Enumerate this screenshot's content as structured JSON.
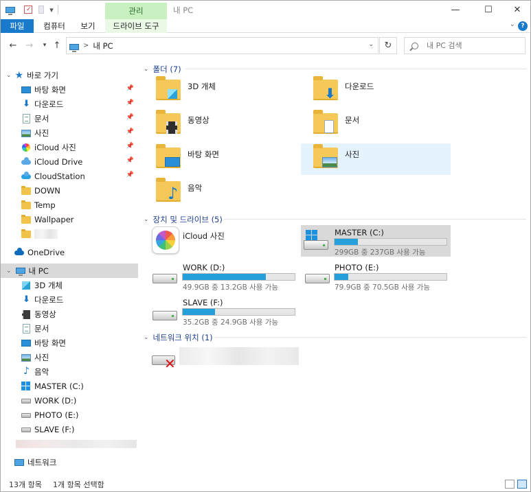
{
  "title_bar": {
    "context_tab_label": "관리",
    "window_title": "내 PC",
    "minimize_glyph": "—",
    "maximize_glyph": "☐",
    "close_glyph": "✕"
  },
  "ribbon": {
    "tabs": [
      {
        "label": "파일"
      },
      {
        "label": "컴퓨터"
      },
      {
        "label": "보기"
      },
      {
        "label": "드라이브 도구"
      }
    ],
    "help_glyph": "?"
  },
  "address_bar": {
    "separator": ">",
    "path": "내 PC",
    "search_placeholder": "내 PC 검색"
  },
  "nav_pane": {
    "quick_access": {
      "label": "바로 가기",
      "items": [
        {
          "label": "바탕 화면",
          "icon": "desktop-icon",
          "pinned": true
        },
        {
          "label": "다운로드",
          "icon": "download-icon",
          "pinned": true
        },
        {
          "label": "문서",
          "icon": "document-icon",
          "pinned": true
        },
        {
          "label": "사진",
          "icon": "pictures-icon",
          "pinned": true
        },
        {
          "label": "iCloud 사진",
          "icon": "icloud-photos-icon",
          "pinned": true
        },
        {
          "label": "iCloud Drive",
          "icon": "icloud-drive-icon",
          "pinned": true
        },
        {
          "label": "CloudStation",
          "icon": "cloudstation-icon",
          "pinned": true
        },
        {
          "label": "DOWN",
          "icon": "folder-icon",
          "pinned": false
        },
        {
          "label": "Temp",
          "icon": "folder-icon",
          "pinned": false
        },
        {
          "label": "Wallpaper",
          "icon": "folder-icon",
          "pinned": false
        }
      ]
    },
    "onedrive": {
      "label": "OneDrive"
    },
    "this_pc": {
      "label": "내 PC",
      "items": [
        {
          "label": "3D 개체",
          "icon": "3d-objects-icon"
        },
        {
          "label": "다운로드",
          "icon": "download-icon"
        },
        {
          "label": "동영상",
          "icon": "videos-icon"
        },
        {
          "label": "문서",
          "icon": "document-icon"
        },
        {
          "label": "바탕 화면",
          "icon": "desktop-icon"
        },
        {
          "label": "사진",
          "icon": "pictures-icon"
        },
        {
          "label": "음악",
          "icon": "music-icon"
        },
        {
          "label": "MASTER (C:)",
          "icon": "system-drive-icon"
        },
        {
          "label": "WORK (D:)",
          "icon": "drive-icon"
        },
        {
          "label": "PHOTO (E:)",
          "icon": "drive-icon"
        },
        {
          "label": "SLAVE (F:)",
          "icon": "drive-icon"
        }
      ]
    },
    "network": {
      "label": "네트워크"
    }
  },
  "main": {
    "folders_group": {
      "header": "폴더 (7)",
      "items": [
        {
          "label": "3D 개체",
          "icon": "3d-objects-folder-icon"
        },
        {
          "label": "다운로드",
          "icon": "downloads-folder-icon"
        },
        {
          "label": "동영상",
          "icon": "videos-folder-icon"
        },
        {
          "label": "문서",
          "icon": "documents-folder-icon"
        },
        {
          "label": "바탕 화면",
          "icon": "desktop-folder-icon"
        },
        {
          "label": "사진",
          "icon": "pictures-folder-icon"
        },
        {
          "label": "음악",
          "icon": "music-folder-icon"
        }
      ]
    },
    "devices_group": {
      "header": "장치 및 드라이브 (5)",
      "items": [
        {
          "label": "iCloud 사진",
          "icon": "icloud-photos-app-icon"
        },
        {
          "label": "MASTER (C:)",
          "icon": "system-drive-icon",
          "usage": "299GB 중 237GB 사용 가능",
          "used_fraction": 0.21
        },
        {
          "label": "WORK (D:)",
          "icon": "drive-icon",
          "usage": "49.9GB 중 13.2GB 사용 가능",
          "used_fraction": 0.74
        },
        {
          "label": "PHOTO (E:)",
          "icon": "drive-icon",
          "usage": "79.9GB 중 70.5GB 사용 가능",
          "used_fraction": 0.12
        },
        {
          "label": "SLAVE (F:)",
          "icon": "drive-icon",
          "usage": "35.2GB 중 24.9GB 사용 가능",
          "used_fraction": 0.29
        }
      ]
    },
    "network_group": {
      "header": "네트워크 위치 (1)"
    }
  },
  "status_bar": {
    "item_count": "13개 항목",
    "selection": "1개 항목 선택함"
  },
  "colors": {
    "accent": "#1979ca",
    "context_tab": "#c9f0c0",
    "drive_bar": "#26a0da",
    "selection": "#e5f3ff",
    "group_header": "#1e3f8f"
  }
}
